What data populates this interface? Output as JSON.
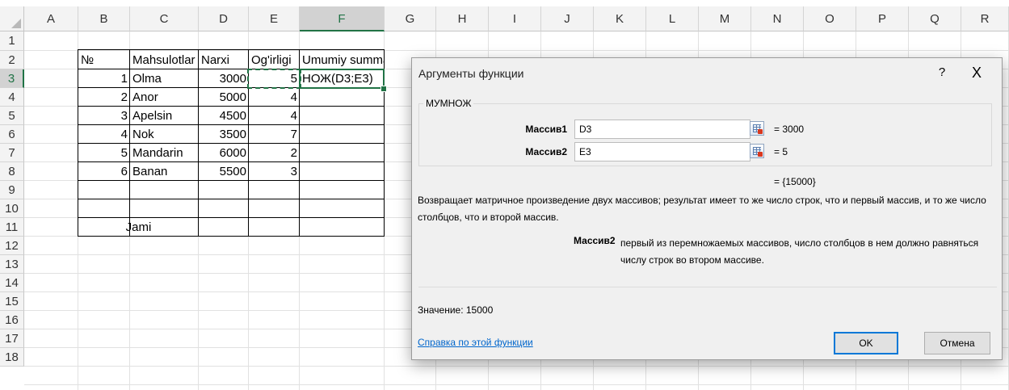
{
  "sheet": {
    "columns": [
      "A",
      "B",
      "C",
      "D",
      "E",
      "F",
      "G",
      "H",
      "I",
      "J",
      "K",
      "L",
      "M",
      "N",
      "O",
      "P",
      "Q",
      "R"
    ],
    "rows": [
      "1",
      "2",
      "3",
      "4",
      "5",
      "6",
      "7",
      "8",
      "9",
      "10",
      "11",
      "12",
      "13",
      "14",
      "15",
      "16",
      "17",
      "18"
    ],
    "selected_column": "F",
    "selected_row": "3",
    "headers": {
      "b": "№",
      "c": "Mahsulotlar",
      "d": "Narxi",
      "e": "Og'irligi",
      "f": "Umumiy summa"
    },
    "data_rows": [
      {
        "num": "1",
        "product": "Olma",
        "price": "3000",
        "weight": "5"
      },
      {
        "num": "2",
        "product": "Anor",
        "price": "5000",
        "weight": "4"
      },
      {
        "num": "3",
        "product": "Apelsin",
        "price": "4500",
        "weight": "4"
      },
      {
        "num": "4",
        "product": "Nok",
        "price": "3500",
        "weight": "7"
      },
      {
        "num": "5",
        "product": "Mandarin",
        "price": "6000",
        "weight": "2"
      },
      {
        "num": "6",
        "product": "Banan",
        "price": "5500",
        "weight": "3"
      }
    ],
    "editing_formula": "НОЖ(D3;E3)",
    "total_label": "Jami",
    "accent_color": "#217346"
  },
  "dialog": {
    "title": "Аргументы функции",
    "help_glyph": "?",
    "close_glyph": "X",
    "function_name": "МУМНОЖ",
    "args": [
      {
        "label": "Массив1",
        "value": "D3",
        "result": "=  3000"
      },
      {
        "label": "Массив2",
        "value": "E3",
        "result": "=  5"
      }
    ],
    "formula_result": "=  {15000}",
    "description": "Возвращает матричное произведение двух массивов; результат имеет то же число строк, что и первый массив, и то же число столбцов, что и второй массив.",
    "arg_desc_name": "Массив2",
    "arg_desc_text": "первый из перемножаемых массивов, число столбцов в нем должно равняться числу строк во втором массиве.",
    "value_label": "Значение:  15000",
    "help_link": "Справка по этой функции",
    "ok_label": "OK",
    "cancel_label": "Отмена",
    "ref_icon": "range-select-icon"
  }
}
